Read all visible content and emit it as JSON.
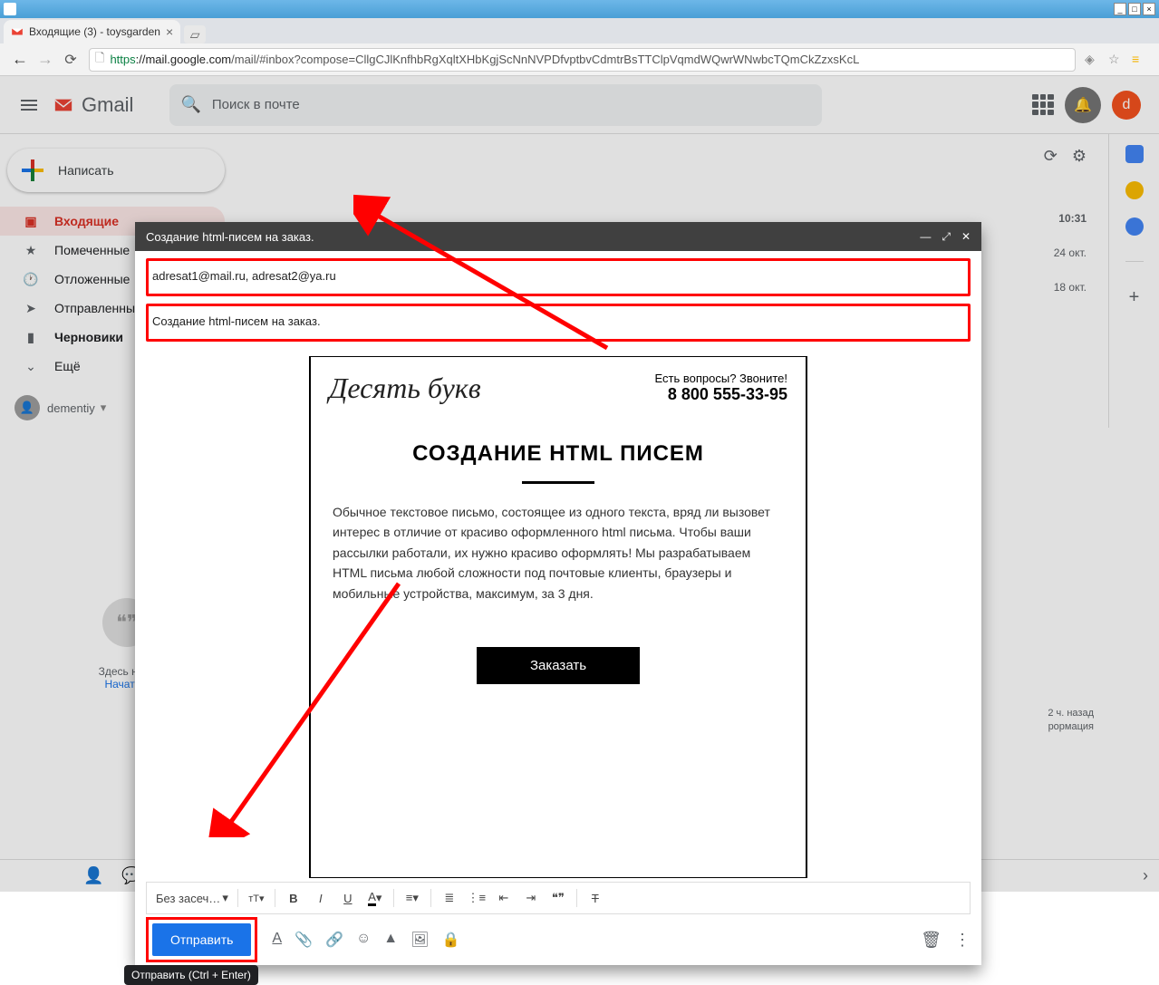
{
  "browser": {
    "tab_title": "Входящие (3) - toysgarden",
    "url_https": "https",
    "url_domain": "://mail.google.com",
    "url_path": "/mail/#inbox?compose=CllgCJlKnfhbRgXqltXHbKgjScNnNVPDfvptbvCdmtrBsTTClpVqmdWQwrWNwbcTQmCkZzxsKcL"
  },
  "gmail": {
    "product": "Gmail",
    "search_placeholder": "Поиск в почте",
    "avatar_letter": "d",
    "compose_label": "Написать",
    "nav": {
      "inbox": "Входящие",
      "starred": "Помеченные",
      "snoozed": "Отложенные",
      "sent": "Отправленные",
      "drafts": "Черновики",
      "more": "Ещё"
    },
    "user": "dementiy",
    "hangouts_empty": "Здесь ниче",
    "hangouts_start": "Начать ч",
    "times": {
      "t1": "10:31",
      "t2": "24 окт.",
      "t3": "18 окт."
    },
    "float_note1": "2 ч. назад",
    "float_note2": "рормация"
  },
  "compose": {
    "title": "Создание html-писем на заказ.",
    "to": "adresat1@mail.ru, adresat2@ya.ru",
    "subject": "Создание html-писем на заказ.",
    "font_family": "Без засеч…",
    "send": "Отправить",
    "tooltip": "Отправить (Ctrl + Enter)"
  },
  "email_body": {
    "brand": "Десять букв",
    "cta_q": "Есть вопросы? Звоните!",
    "phone": "8 800 555-33-95",
    "heading": "СОЗДАНИЕ HTML ПИСЕМ",
    "paragraph": "Обычное текстовое письмо, состоящее из одного текста, вряд ли вызовет интерес в отличие от красиво оформленного html письма. Чтобы ваши рассылки работали, их нужно красиво оформлять! Мы разрабатываем HTML письма любой сложности под почтовые клиенты, браузеры и мобильные устройства, максимум, за 3 дня.",
    "button": "Заказать"
  }
}
